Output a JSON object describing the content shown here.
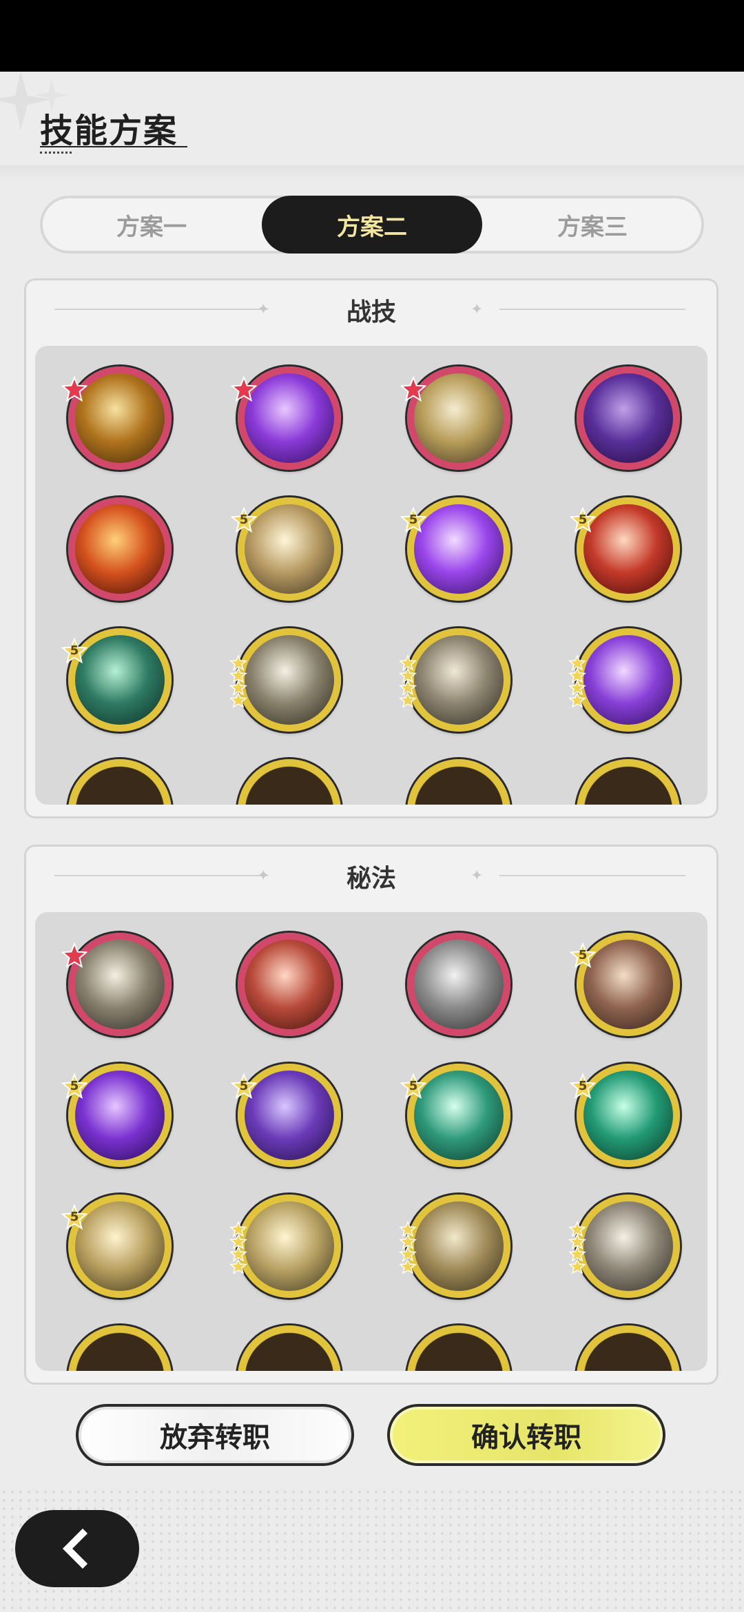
{
  "header": {
    "title": "技能方案"
  },
  "tabs": [
    {
      "label": "方案一",
      "active": false
    },
    {
      "label": "方案二",
      "active": true
    },
    {
      "label": "方案三",
      "active": false
    }
  ],
  "combat_section": {
    "title": "战技",
    "skills": [
      {
        "icon": "golden-slash-icon",
        "rarity": "red",
        "badge": "star-red"
      },
      {
        "icon": "purple-roses-icon",
        "rarity": "red",
        "badge": "star-red"
      },
      {
        "icon": "grasping-hand-icon",
        "rarity": "red",
        "badge": "star-red"
      },
      {
        "icon": "shadow-claw-icon",
        "rarity": "red",
        "badge": ""
      },
      {
        "icon": "flame-icon",
        "rarity": "red",
        "badge": ""
      },
      {
        "icon": "burst-explosion-icon",
        "rarity": "gold",
        "badge": "5"
      },
      {
        "icon": "purple-swirl-icon",
        "rarity": "gold",
        "badge": "5"
      },
      {
        "icon": "raised-blade-icon",
        "rarity": "gold",
        "badge": "5"
      },
      {
        "icon": "spider-web-icon",
        "rarity": "gold",
        "badge": "5"
      },
      {
        "icon": "wind-slash-icon",
        "rarity": "gold",
        "badge": "stars"
      },
      {
        "icon": "whirl-icon",
        "rarity": "gold",
        "badge": "stars"
      },
      {
        "icon": "purple-heart-icon",
        "rarity": "gold",
        "badge": "stars"
      }
    ]
  },
  "arcane_section": {
    "title": "秘法",
    "skills": [
      {
        "icon": "maple-leaf-icon",
        "rarity": "red",
        "badge": "star-red"
      },
      {
        "icon": "fist-strike-icon",
        "rarity": "red",
        "badge": ""
      },
      {
        "icon": "shield-runner-icon",
        "rarity": "red",
        "badge": ""
      },
      {
        "icon": "heart-shield-icon",
        "rarity": "gold",
        "badge": "5"
      },
      {
        "icon": "purple-fire-icon",
        "rarity": "gold",
        "badge": "5"
      },
      {
        "icon": "dash-silhouette-icon",
        "rarity": "gold",
        "badge": "5"
      },
      {
        "icon": "heal-plus-icon",
        "rarity": "gold",
        "badge": "5"
      },
      {
        "icon": "green-sword-icon",
        "rarity": "gold",
        "badge": "5"
      },
      {
        "icon": "heal-figure-icon",
        "rarity": "gold",
        "badge": "5"
      },
      {
        "icon": "eye-icon",
        "rarity": "gold",
        "badge": "stars"
      },
      {
        "icon": "hand-strike-icon",
        "rarity": "gold",
        "badge": "stars"
      },
      {
        "icon": "sword-up-icon",
        "rarity": "gold",
        "badge": "stars"
      }
    ]
  },
  "buttons": {
    "cancel": "放弃转职",
    "confirm": "确认转职"
  },
  "colors": {
    "tab_active_bg": "#1c1c1c",
    "tab_active_text": "#f3e6a0",
    "confirm_bg": "#e8e76c",
    "red_ring": "#d2486b",
    "gold_ring": "#e2c43c"
  }
}
